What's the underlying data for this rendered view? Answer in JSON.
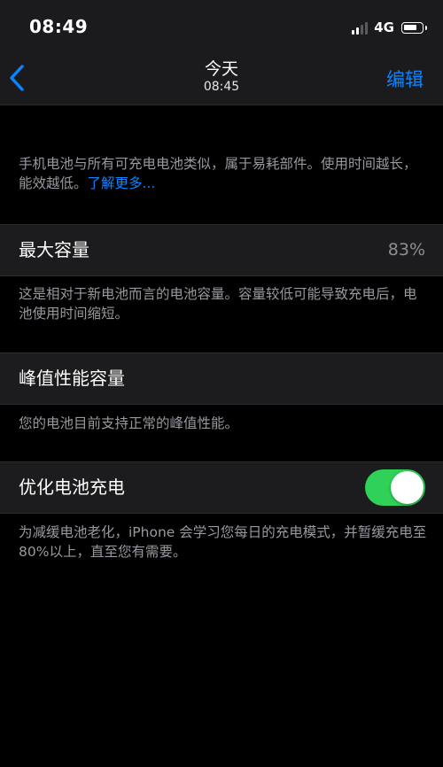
{
  "status_bar": {
    "time": "08:49",
    "network": "4G",
    "signal_bars_active": 2,
    "signal_bars_total": 4,
    "battery_level": 0.8
  },
  "nav": {
    "back_icon": "chevron-left-icon",
    "title": "今天",
    "subtitle": "08:45",
    "edit_label": "编辑"
  },
  "intro": {
    "text": "手机电池与所有可充电电池类似，属于易耗部件。使用时间越长，能效越低。",
    "link": "了解更多..."
  },
  "max_capacity": {
    "label": "最大容量",
    "value": "83%",
    "footer": "这是相对于新电池而言的电池容量。容量较低可能导致充电后，电池使用时间缩短。"
  },
  "peak_performance": {
    "label": "峰值性能容量",
    "footer": "您的电池目前支持正常的峰值性能。"
  },
  "optimized_charging": {
    "label": "优化电池充电",
    "enabled": true,
    "footer": "为减缓电池老化，iPhone 会学习您每日的充电模式，并暂缓充电至80%以上，直至您有需要。"
  },
  "colors": {
    "accent": "#0a84ff",
    "toggle_on": "#30d158",
    "background": "#000000",
    "cell_background": "#1c1c1e",
    "secondary_text": "#98989f"
  }
}
